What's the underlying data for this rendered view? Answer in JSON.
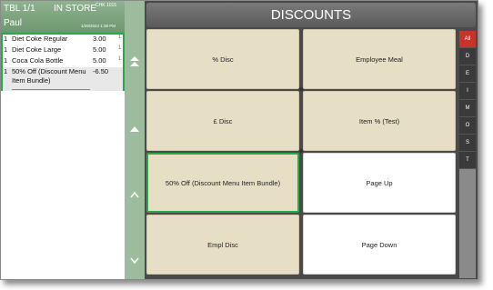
{
  "header": {
    "table": "TBL 1/1",
    "mode": "IN STORE",
    "check": "CHK 1015",
    "server": "Paul",
    "date": "1/29/2024 1:38 PM"
  },
  "order": {
    "items": [
      {
        "qty": "1",
        "name": "Diet Coke Regular",
        "price": "3.00",
        "tick": "1"
      },
      {
        "qty": "1",
        "name": "Diet Coke Large",
        "price": "5.00",
        "tick": "1"
      },
      {
        "qty": "1",
        "name": "Coca Cola Bottle",
        "price": "5.00",
        "tick": "1"
      },
      {
        "qty": "1",
        "name": "50% Off (Discount Menu Item Bundle)",
        "price": "-6.50",
        "tick": ""
      }
    ]
  },
  "nav": {
    "top": "⏶",
    "up": "▲",
    "prev": "^",
    "down": "v"
  },
  "main": {
    "title": "DISCOUNTS",
    "buttons": [
      {
        "label": "% Disc"
      },
      {
        "label": "Employee Meal"
      },
      {
        "label": "£ Disc"
      },
      {
        "label": "Item % (Test)"
      },
      {
        "label": "50% Off (Discount Menu Item Bundle)"
      },
      {
        "label": "Page Up"
      },
      {
        "label": "Empl Disc"
      },
      {
        "label": "Page Down"
      }
    ]
  },
  "tabs": [
    "All",
    "D",
    "E",
    "I",
    "M",
    "O",
    "S",
    "T"
  ],
  "colors": {
    "accent_green": "#27a84a",
    "header_green": "#7da47e",
    "active_tab": "#c8332a",
    "tile_beige": "#e6dfc6"
  }
}
